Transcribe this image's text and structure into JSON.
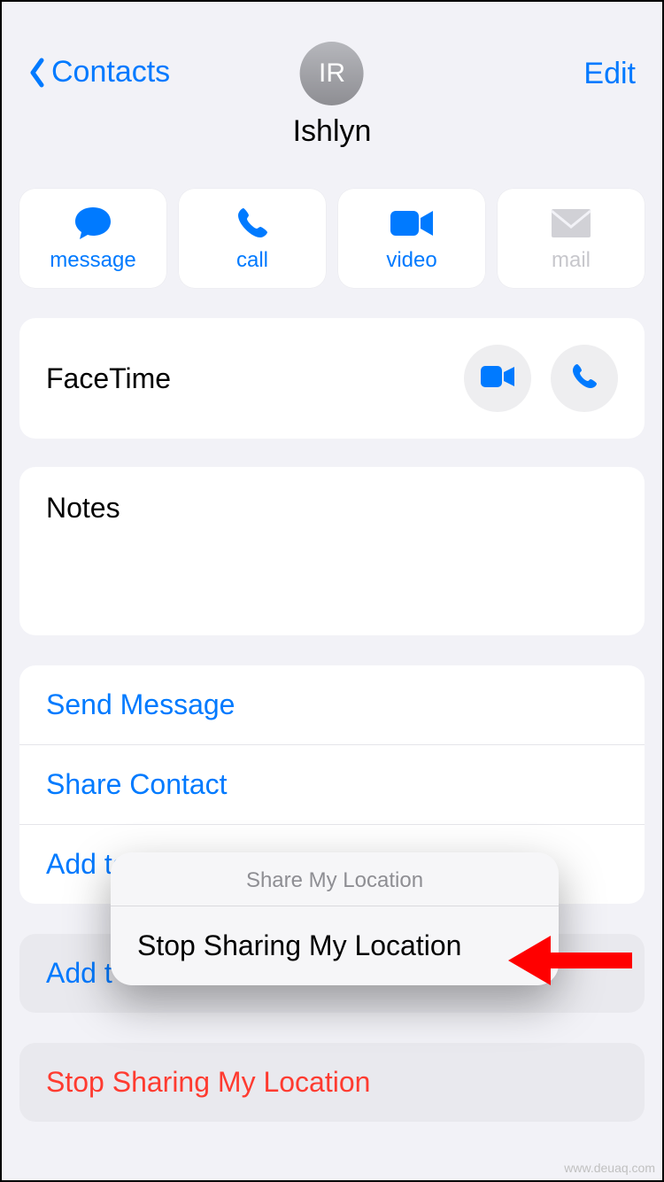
{
  "header": {
    "back_label": "Contacts",
    "edit_label": "Edit",
    "initials": "IR",
    "contact_name": "Ishlyn"
  },
  "actions": {
    "message": "message",
    "call": "call",
    "video": "video",
    "mail": "mail"
  },
  "facetime": {
    "label": "FaceTime"
  },
  "notes": {
    "label": "Notes"
  },
  "options": {
    "send_message": "Send Message",
    "share_contact": "Share Contact",
    "add_favorites": "Add to Favorites"
  },
  "lower_options": {
    "add_truncated": "Add t",
    "stop_sharing": "Stop Sharing My Location"
  },
  "popup": {
    "title": "Share My Location",
    "action": "Stop Sharing My Location"
  },
  "watermark": "www.deuaq.com",
  "colors": {
    "accent": "#007aff",
    "destructive": "#ff3b30",
    "disabled": "#c7c7cc",
    "background": "#f2f2f7"
  }
}
